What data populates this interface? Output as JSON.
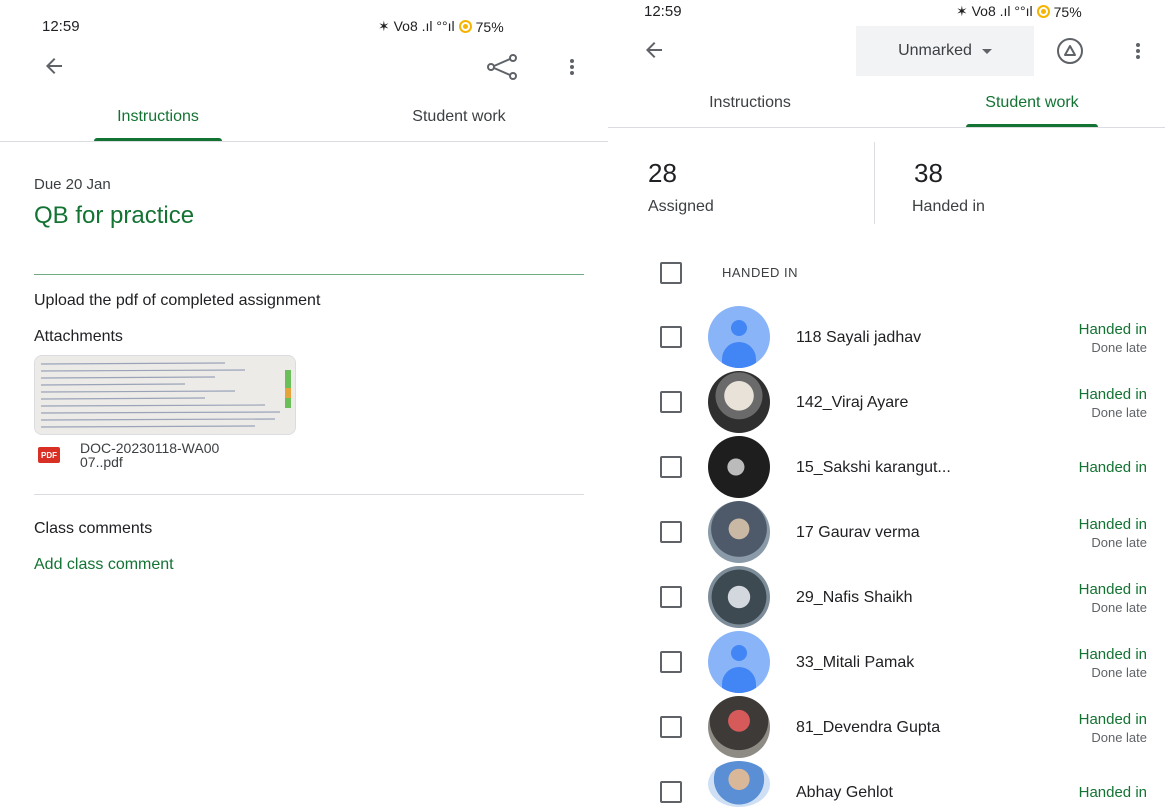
{
  "left_screen": {
    "status_bar": {
      "time": "12:59",
      "signal_text": "✶ Vo8 .ıl °°ıl",
      "battery": "75%"
    },
    "toolbar": {
      "back_icon": "arrow-back-icon",
      "share_icon": "share-icon",
      "more_icon": "more-vert-icon"
    },
    "tabs": [
      {
        "label": "Instructions",
        "active": true
      },
      {
        "label": "Student work",
        "active": false
      }
    ],
    "assignment": {
      "due": "Due 20 Jan",
      "title": "QB for practice",
      "description": "Upload the pdf of completed assignment",
      "attachments_label": "Attachments",
      "attachment": {
        "type_badge": "PDF",
        "file_name_line1": "DOC-20230118-WA00",
        "file_name_line2": "07..pdf"
      }
    },
    "comments": {
      "label": "Class comments",
      "add_link": "Add class comment"
    }
  },
  "right_screen": {
    "status_bar": {
      "time": "12:59",
      "signal_text": "✶ Vo8 .ıl °°ıl",
      "battery": "75%"
    },
    "toolbar": {
      "back_icon": "arrow-back-icon",
      "filter_value": "Unmarked",
      "drive_icon": "drive-icon",
      "more_icon": "more-vert-icon"
    },
    "tabs": [
      {
        "label": "Instructions",
        "active": false
      },
      {
        "label": "Student work",
        "active": true
      }
    ],
    "stats": [
      {
        "value": "28",
        "label": "Assigned"
      },
      {
        "value": "38",
        "label": "Handed in"
      }
    ],
    "group_header": "HANDED IN",
    "students": [
      {
        "name": "118 Sayali jadhav",
        "status": "Handed in",
        "sub": "Done late",
        "avatar": "default"
      },
      {
        "name": "142_Viraj Ayare",
        "status": "Handed in",
        "sub": "Done late",
        "avatar": "photo"
      },
      {
        "name": "15_Sakshi karangut...",
        "status": "Handed in",
        "sub": "",
        "avatar": "photo"
      },
      {
        "name": "17 Gaurav verma",
        "status": "Handed in",
        "sub": "Done late",
        "avatar": "photo"
      },
      {
        "name": "29_Nafis Shaikh",
        "status": "Handed in",
        "sub": "Done late",
        "avatar": "photo"
      },
      {
        "name": "33_Mitali Pamak",
        "status": "Handed in",
        "sub": "Done late",
        "avatar": "default"
      },
      {
        "name": "81_Devendra Gupta",
        "status": "Handed in",
        "sub": "Done late",
        "avatar": "photo"
      },
      {
        "name": "Abhay Gehlot",
        "status": "Handed in",
        "sub": "",
        "avatar": "photo"
      }
    ]
  }
}
